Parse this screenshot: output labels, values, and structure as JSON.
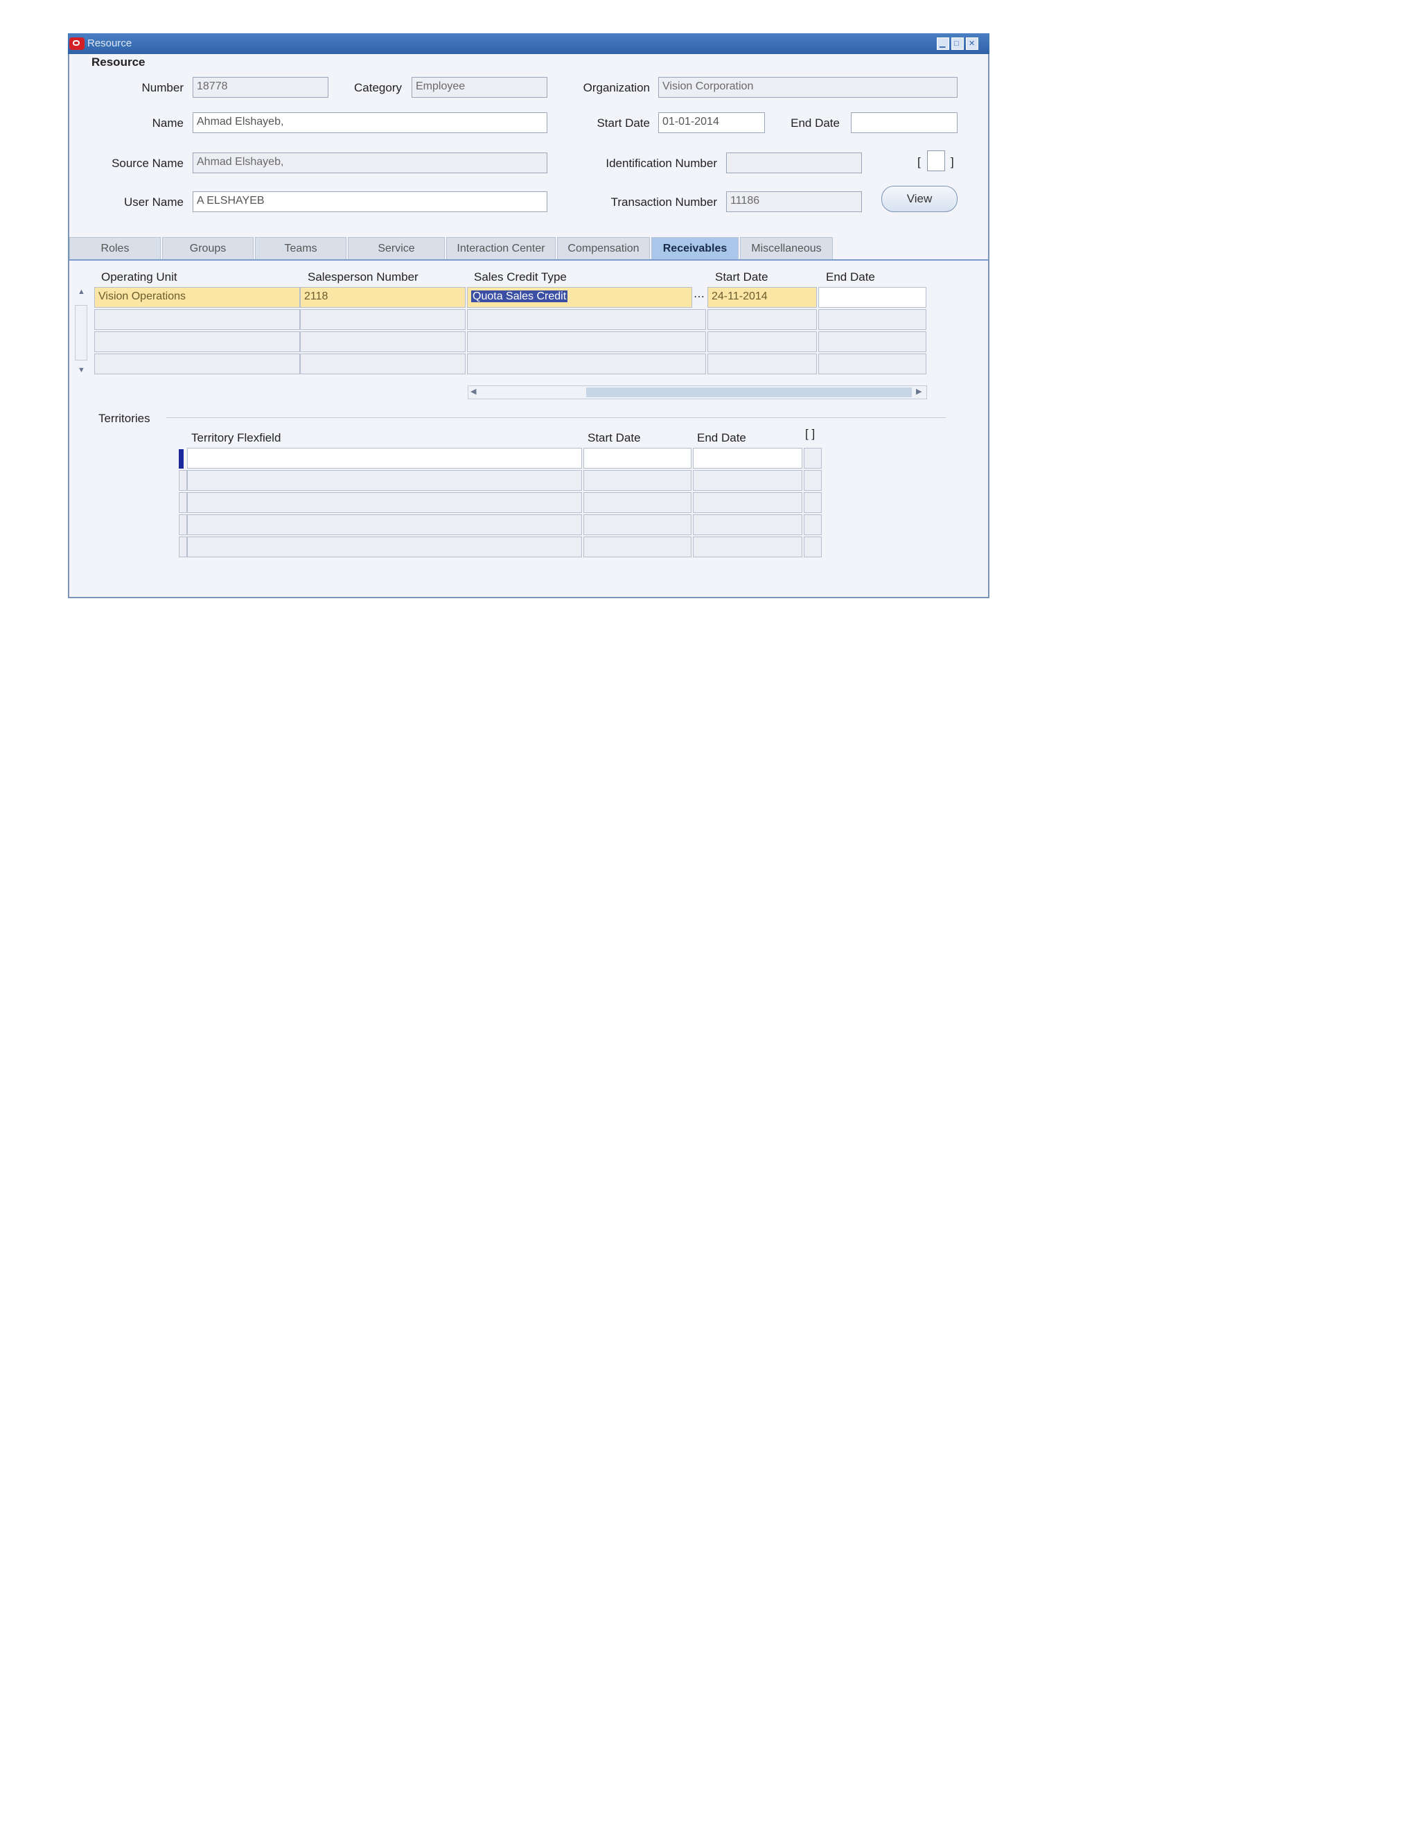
{
  "window": {
    "title": "Resource"
  },
  "resource": {
    "section_title": "Resource",
    "number_label": "Number",
    "number": "18778",
    "category_label": "Category",
    "category": "Employee",
    "organization_label": "Organization",
    "organization": "Vision Corporation",
    "name_label": "Name",
    "name": "Ahmad Elshayeb,",
    "start_date_label": "Start Date",
    "start_date": "01-01-2014",
    "end_date_label": "End Date",
    "end_date": "",
    "source_name_label": "Source Name",
    "source_name": "Ahmad Elshayeb,",
    "identification_label": "Identification Number",
    "identification": "",
    "user_name_label": "User Name",
    "user_name": "A ELSHAYEB",
    "transaction_label": "Transaction Number",
    "transaction": "11186",
    "view_button": "View",
    "bracket_left": "[",
    "bracket_right": "]"
  },
  "tabs": [
    "Roles",
    "Groups",
    "Teams",
    "Service",
    "Interaction Center",
    "Compensation",
    "Receivables",
    "Miscellaneous"
  ],
  "receivables": {
    "headers": [
      "Operating Unit",
      "Salesperson Number",
      "Sales Credit Type",
      "Start Date",
      "End Date"
    ],
    "rows": [
      {
        "operating_unit": "Vision Operations",
        "salesperson_number": "2118",
        "sales_credit_type": "Quota Sales Credit",
        "start_date": "24-11-2014",
        "end_date": ""
      }
    ]
  },
  "territories": {
    "label": "Territories",
    "headers": [
      "Territory Flexfield",
      "Start Date",
      "End Date"
    ],
    "bracket": "[ ]"
  }
}
